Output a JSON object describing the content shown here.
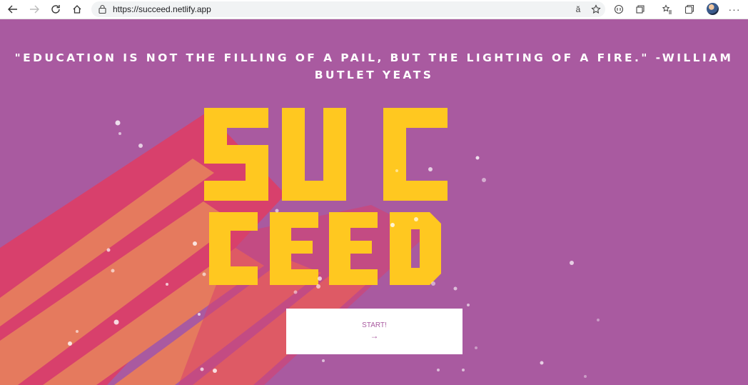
{
  "browser": {
    "url": "https://succeed.netlify.app",
    "icons": [
      "back-icon",
      "forward-icon",
      "refresh-icon",
      "home-icon",
      "lock-icon",
      "read-aloud-icon",
      "favorite-add-icon",
      "extension-icon",
      "collections-icon",
      "favorites-icon",
      "tab-actions-icon",
      "profile-avatar",
      "more-options-icon"
    ]
  },
  "hero": {
    "quote": "\"EDUCATION IS NOT THE FILLING OF A PAIL, BUT THE LIGHTING OF A FIRE.\" -WILLIAM BUTLET YEATS",
    "logo_line1": "SUC",
    "logo_line2": "CEED",
    "start_label": "START!",
    "start_arrow": "→"
  },
  "colors": {
    "background": "#a95aa0",
    "logo_yellow": "#ffc820",
    "stripe_pink": "#d8406c",
    "stripe_orange": "#e57a5e",
    "button_text": "#a95aa0"
  }
}
